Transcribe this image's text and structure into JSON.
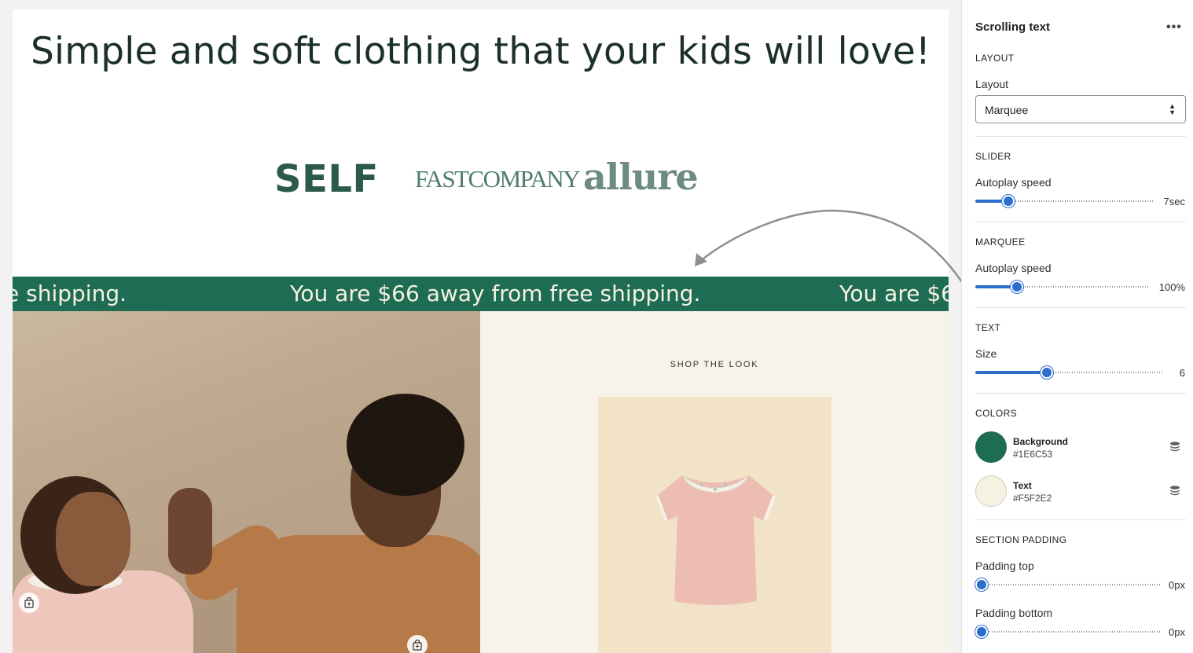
{
  "preview": {
    "headline": "Simple and soft clothing that your kids will love!",
    "logos": {
      "self": "SELF",
      "fast_company": "FASTCOMPANY",
      "allure": "allure"
    },
    "marquee": {
      "text_left": "e shipping.",
      "text_center": "You are $66 away from free shipping.",
      "text_right": "You are $6"
    },
    "shop_the_look": "SHOP THE LOOK"
  },
  "panel": {
    "title": "Scrolling text",
    "more_icon": "more-horizontal-icon",
    "layout": {
      "heading": "LAYOUT",
      "label": "Layout",
      "value": "Marquee"
    },
    "slider": {
      "heading": "SLIDER",
      "label": "Autoplay speed",
      "value": "7sec",
      "fraction": 0.16
    },
    "marquee": {
      "heading": "MARQUEE",
      "label": "Autoplay speed",
      "value": "100%",
      "fraction": 0.22
    },
    "text": {
      "heading": "TEXT",
      "label": "Size",
      "value": "6",
      "fraction": 0.37
    },
    "colors": {
      "heading": "COLORS",
      "background": {
        "name": "Background",
        "hex": "#1E6C53"
      },
      "text": {
        "name": "Text",
        "hex": "#F5F2E2"
      }
    },
    "padding": {
      "heading": "SECTION PADDING",
      "top_label": "Padding top",
      "top_value": "0px",
      "top_fraction": 0,
      "bottom_label": "Padding bottom",
      "bottom_value": "0px",
      "bottom_fraction": 0
    }
  }
}
